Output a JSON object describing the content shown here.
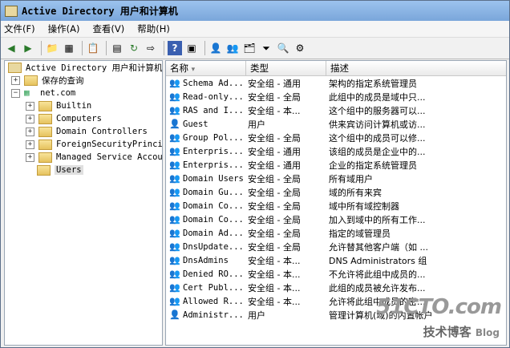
{
  "window": {
    "title": "Active Directory 用户和计算机"
  },
  "menu": [
    "文件(F)",
    "操作(A)",
    "查看(V)",
    "帮助(H)"
  ],
  "tree": {
    "root": "Active Directory 用户和计算机",
    "saved": "保存的查询",
    "domain": "net.com",
    "children": [
      "Builtin",
      "Computers",
      "Domain Controllers",
      "ForeignSecurityPrincipals",
      "Managed Service Accounts",
      "Users"
    ]
  },
  "list": {
    "columns": [
      "名称",
      "类型",
      "描述"
    ],
    "rows": [
      {
        "name": "Schema Ad...",
        "type": "安全组 - 通用",
        "desc": "架构的指定系统管理员",
        "icon": "group"
      },
      {
        "name": "Read-only...",
        "type": "安全组 - 全局",
        "desc": "此组中的成员是域中只...",
        "icon": "group"
      },
      {
        "name": "RAS and I...",
        "type": "安全组 - 本...",
        "desc": "这个组中的服务器可以...",
        "icon": "group"
      },
      {
        "name": "Guest",
        "type": "用户",
        "desc": "供来宾访问计算机或访...",
        "icon": "user"
      },
      {
        "name": "Group Pol...",
        "type": "安全组 - 全局",
        "desc": "这个组中的成员可以修...",
        "icon": "group"
      },
      {
        "name": "Enterpris...",
        "type": "安全组 - 通用",
        "desc": "该组的成员是企业中的...",
        "icon": "group"
      },
      {
        "name": "Enterpris...",
        "type": "安全组 - 通用",
        "desc": "企业的指定系统管理员",
        "icon": "group"
      },
      {
        "name": "Domain Users",
        "type": "安全组 - 全局",
        "desc": "所有域用户",
        "icon": "group"
      },
      {
        "name": "Domain Gu...",
        "type": "安全组 - 全局",
        "desc": "域的所有来宾",
        "icon": "group"
      },
      {
        "name": "Domain Co...",
        "type": "安全组 - 全局",
        "desc": "域中所有域控制器",
        "icon": "group"
      },
      {
        "name": "Domain Co...",
        "type": "安全组 - 全局",
        "desc": "加入到域中的所有工作...",
        "icon": "group"
      },
      {
        "name": "Domain Ad...",
        "type": "安全组 - 全局",
        "desc": "指定的域管理员",
        "icon": "group"
      },
      {
        "name": "DnsUpdate...",
        "type": "安全组 - 全局",
        "desc": "允许替其他客户端（如 ...",
        "icon": "group"
      },
      {
        "name": "DnsAdmins",
        "type": "安全组 - 本...",
        "desc": "DNS Administrators 组",
        "icon": "group"
      },
      {
        "name": "Denied RO...",
        "type": "安全组 - 本...",
        "desc": "不允许将此组中成员的...",
        "icon": "group"
      },
      {
        "name": "Cert Publ...",
        "type": "安全组 - 本...",
        "desc": "此组的成员被允许发布...",
        "icon": "group"
      },
      {
        "name": "Allowed R...",
        "type": "安全组 - 本...",
        "desc": "允许将此组中成员的密...",
        "icon": "group"
      },
      {
        "name": "Administr...",
        "type": "用户",
        "desc": "管理计算机(域)的内置帐户",
        "icon": "user"
      }
    ]
  },
  "watermark": {
    "site": "51CTO.com",
    "sub": "技术博客",
    "tag": "Blog"
  }
}
